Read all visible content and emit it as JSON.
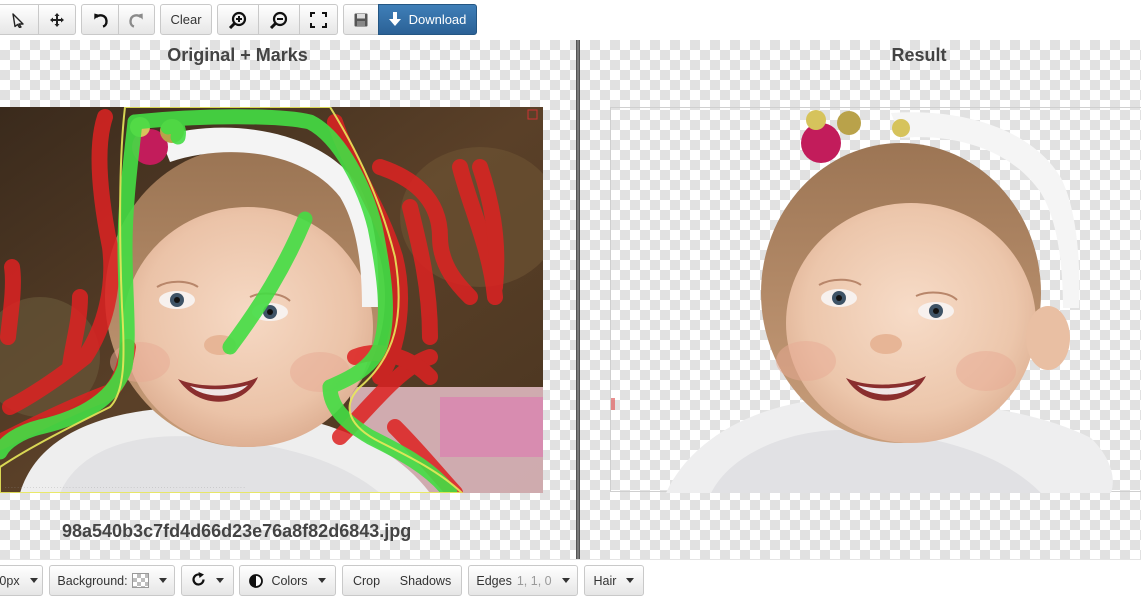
{
  "toolbar": {
    "clear_label": "Clear",
    "download_label": "Download",
    "icons": {
      "select": "select-arrow-icon",
      "move": "move-cross-icon",
      "undo": "undo-icon",
      "redo": "redo-icon",
      "zoom_in": "zoom-in-icon",
      "zoom_out": "zoom-out-icon",
      "fit": "fit-screen-icon",
      "save": "save-icon",
      "download": "download-arrow-icon"
    }
  },
  "panes": {
    "left_title": "Original + Marks",
    "right_title": "Result",
    "filename": "98a540b3c7fd4d66d23e76a8f82d6843.jpg"
  },
  "marks": {
    "keep_color": "#44dd44",
    "remove_color": "#dd2222",
    "edge_color": "#e8e85a"
  },
  "bottombar": {
    "brush_size": "0px",
    "background_label": "Background:",
    "colors_label": "Colors",
    "crop_label": "Crop",
    "shadows_label": "Shadows",
    "edges_label": "Edges",
    "edges_value": "1, 1, 0",
    "hair_label": "Hair"
  },
  "colors": {
    "primary": "#2d6aa3",
    "divider": "#555555"
  }
}
